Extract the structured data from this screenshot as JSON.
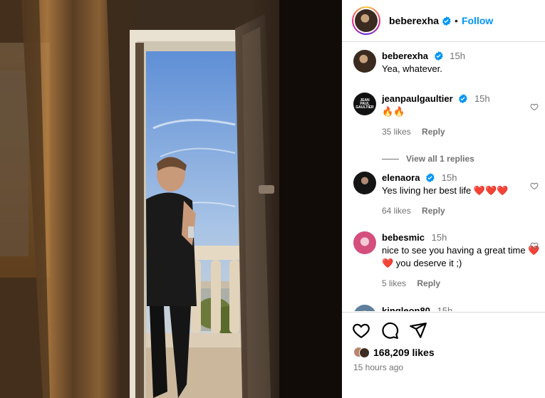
{
  "post": {
    "author": "beberexha",
    "follow_label": "Follow",
    "separator": "•",
    "likes_label": "168,209 likes",
    "time_ago": "15 hours ago"
  },
  "comments": [
    {
      "user": "beberexha",
      "verified": true,
      "time": "15h",
      "text": "Yea, whatever.",
      "likes": "",
      "reply": ""
    },
    {
      "user": "jeanpaulgaultier",
      "verified": true,
      "time": "15h",
      "text": "🔥🔥",
      "likes": "35 likes",
      "reply": "Reply",
      "avatar_text": "JEAN PAUL GAULTIER"
    },
    {
      "user": "elenaora",
      "verified": true,
      "time": "15h",
      "text": "Yes living her best life ❤️❤️❤️",
      "likes": "64 likes",
      "reply": "Reply"
    },
    {
      "user": "bebesmic",
      "verified": false,
      "time": "15h",
      "text": "nice to see you having a great time ❤️❤️ you deserve it ;)",
      "likes": "5 likes",
      "reply": "Reply"
    },
    {
      "user": "kingleon80",
      "verified": false,
      "time": "15h",
      "text": "",
      "likes": "",
      "reply": ""
    }
  ],
  "view_replies": "View all 1 replies",
  "icons": {
    "like": "heart-icon",
    "comment": "comment-icon",
    "share": "share-icon",
    "verified": "verified-badge-icon"
  },
  "colors": {
    "follow": "#0095f6",
    "verified": "#0095f6",
    "meta": "#737373",
    "border": "#dbdbdb"
  }
}
